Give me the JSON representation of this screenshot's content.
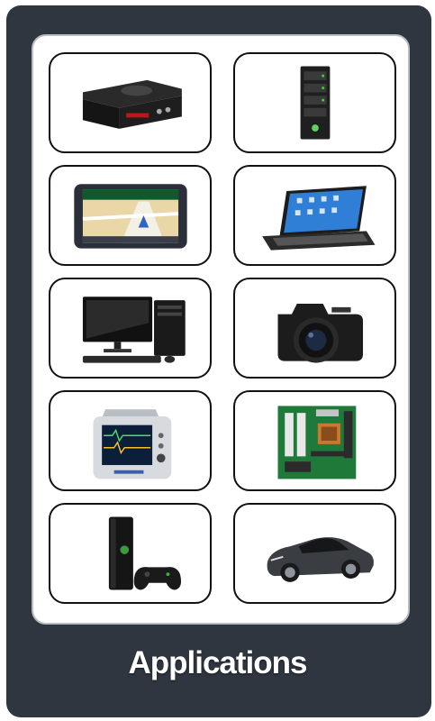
{
  "title": "Applications",
  "tiles": [
    {
      "name": "cd-player-icon"
    },
    {
      "name": "server-tower-icon"
    },
    {
      "name": "gps-navigator-icon"
    },
    {
      "name": "tablet-keyboard-icon"
    },
    {
      "name": "desktop-computer-icon"
    },
    {
      "name": "dslr-camera-icon"
    },
    {
      "name": "patient-monitor-icon"
    },
    {
      "name": "motherboard-icon"
    },
    {
      "name": "game-console-icon"
    },
    {
      "name": "sports-car-icon"
    }
  ]
}
